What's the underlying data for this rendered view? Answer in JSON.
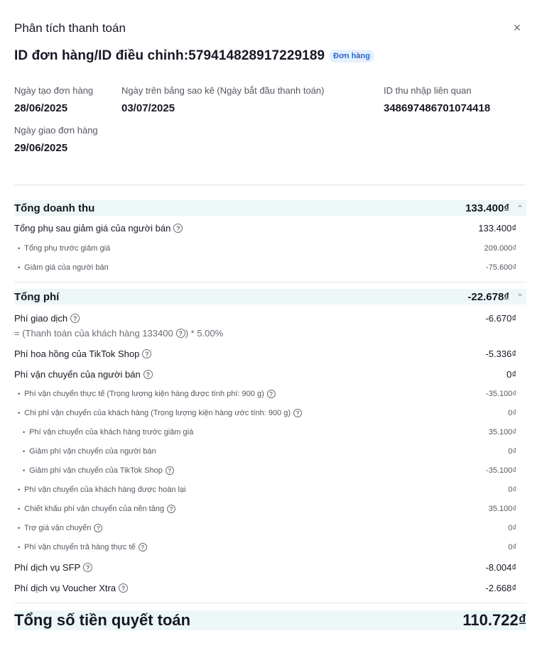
{
  "header": {
    "title": "Phân tích thanh toán",
    "close_icon": "×"
  },
  "order": {
    "id_label": "ID đơn hàng/ID điều chỉnh:579414828917229189",
    "badge": "Đơn hàng"
  },
  "info": {
    "created": {
      "label": "Ngày tạo đơn hàng",
      "value": "28/06/2025"
    },
    "statement": {
      "label": "Ngày trên bảng sao kê (Ngày bắt đầu thanh toán)",
      "value": "03/07/2025"
    },
    "income_id": {
      "label": "ID thu nhập liên quan",
      "value": "348697486701074418"
    },
    "delivered": {
      "label": "Ngày giao đơn hàng",
      "value": "29/06/2025"
    }
  },
  "revenue": {
    "title": "Tổng doanh thu",
    "amount": "133.400₫",
    "rows": [
      {
        "label": "Tổng phụ sau giảm giá của người bán",
        "value": "133.400₫"
      },
      {
        "label": "Tổng phụ trước giảm giá",
        "value": "209.000₫"
      },
      {
        "label": "Giảm giá của người bán",
        "value": "-75.600₫"
      }
    ]
  },
  "fees": {
    "title": "Tổng phí",
    "amount": "-22.678₫",
    "transaction": {
      "label": "Phí giao dịch",
      "value": "-6.670₫",
      "formula_prefix": "= (Thanh toán của khách hàng 133400",
      "formula_suffix": ") * 5.00%"
    },
    "rows": [
      {
        "label": "Phí hoa hồng của TikTok Shop",
        "value": "-5.336₫"
      },
      {
        "label": "Phí vận chuyển của người bán",
        "value": "0₫"
      },
      {
        "label": "Phí vận chuyển thực tế (Trọng lượng kiện hàng được tính phí: 900 g)",
        "value": "-35.100₫"
      },
      {
        "label": "Chi phí vận chuyển của khách hàng (Trọng lượng kiện hàng ước tính: 900 g)",
        "value": "0₫"
      },
      {
        "label": "Phí vận chuyển của khách hàng trước giảm giá",
        "value": "35.100₫"
      },
      {
        "label": "Giảm phí vận chuyển của người bán",
        "value": "0₫"
      },
      {
        "label": "Giảm phí vận chuyển của TikTok Shop",
        "value": "-35.100₫"
      },
      {
        "label": "Phí vận chuyển của khách hàng được hoàn lại",
        "value": "0₫"
      },
      {
        "label": "Chiết khấu phí vận chuyển của nền tảng",
        "value": "35.100₫"
      },
      {
        "label": "Trợ giá vận chuyển",
        "value": "0₫"
      },
      {
        "label": "Phí vận chuyển trả hàng thực tế",
        "value": "0₫"
      },
      {
        "label": "Phí dịch vụ SFP",
        "value": "-8.004₫"
      },
      {
        "label": "Phí dịch vụ Voucher Xtra",
        "value": "-2.668₫"
      }
    ]
  },
  "total": {
    "label": "Tổng số tiền quyết toán",
    "value": "110.722₫"
  },
  "icons": {
    "help": "?",
    "collapse": "⌃"
  }
}
